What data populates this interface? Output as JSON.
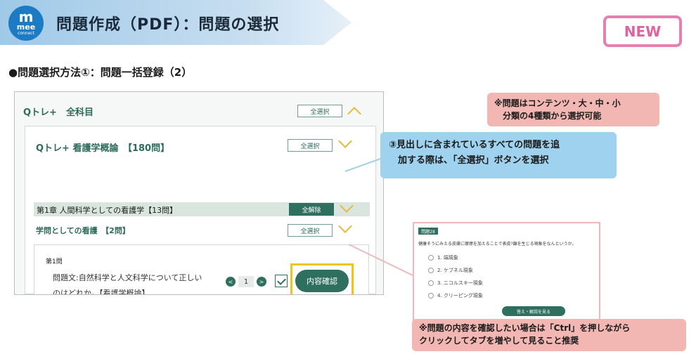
{
  "header": {
    "logo_m": "m",
    "logo_mee": "mee",
    "logo_connect": "connect",
    "title": "問題作成（PDF）：問題の選択"
  },
  "badge": {
    "label": "NEW"
  },
  "section_heading": "●問題選択方法①：問題一括登録（2）",
  "panel": {
    "top_title": "Qトレ+　全科目",
    "top_select_all": "全選択",
    "subject_title": "Qトレ+ 看護学概論　【180問】",
    "subject_select_all": "全選択",
    "chapter_label": "第1章 人間科学としての看護学【13問】",
    "chapter_deselect": "全解除",
    "unit_label": "学問としての看護　【2問】",
    "unit_select_all": "全選択",
    "question": {
      "number": "第1問",
      "text": "問題文:自然科学と人文科学について正しいのはどれか｡【看護学概論】",
      "pager_prev": "<",
      "pager_page": "1",
      "pager_next": ">",
      "confirm_label": "内容確認"
    }
  },
  "callouts": {
    "top_note": "※問題はコンテンツ・大・中・小\n　分類の4種類から選択可能",
    "main_note_line1": "③見出しに含まれているすべての問題を追",
    "main_note_line2": "　加する際は、「全選択」ボタンを選択",
    "bottom_note_line1": "※問題の内容を確認したい場合は「Ctrl」を押しながら",
    "bottom_note_line2": "クリックしてタブを増やして見ること推奨"
  },
  "preview": {
    "tag": "問題28",
    "question": "健康そうにみえる皮膚に摩擦を加えることで表皮?離を生じる現象をなんというか。",
    "options": [
      "1. 端現象",
      "2. ケブネル現象",
      "3. ニコルスキー現象",
      "4. クリーピング現象"
    ],
    "button": "答え・解説を見る"
  },
  "colors": {
    "accent_green": "#2f6f5f",
    "highlight_yellow": "#f2c318",
    "callout_blue": "#9fd2ee",
    "callout_pink": "#f2b7b3",
    "badge_pink": "#e0629e"
  }
}
